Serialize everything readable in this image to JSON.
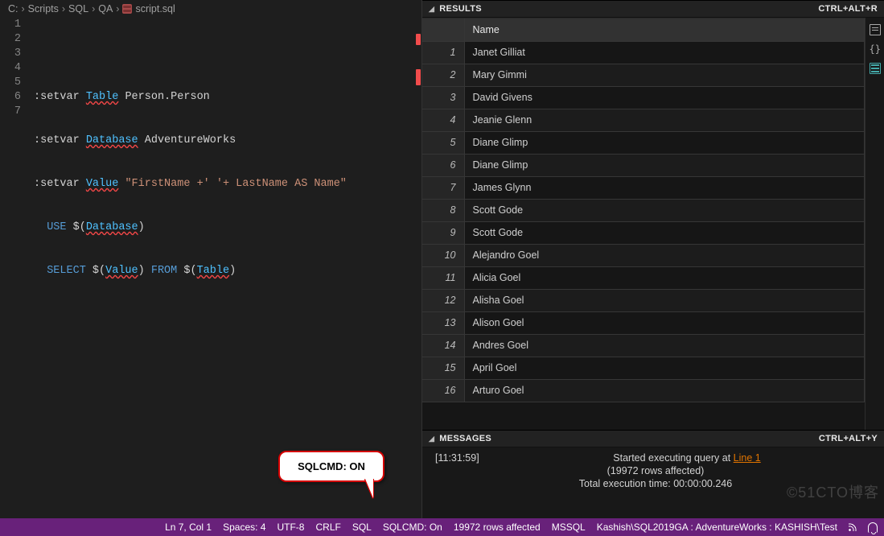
{
  "breadcrumb": [
    "C:",
    "Scripts",
    "SQL",
    "QA",
    "script.sql"
  ],
  "editor": {
    "line_count": 7,
    "tokens": {
      "setvar": ":setvar",
      "table_var": "Table",
      "table_val": "Person.Person",
      "db_var": "Database",
      "db_val": "AdventureWorks",
      "value_var": "Value",
      "value_str": "\"FirstName +' '+ LastName AS Name\"",
      "use": "USE",
      "select": "SELECT",
      "from": "FROM",
      "dollar_open": "$(",
      "close_paren": ")"
    }
  },
  "callout": {
    "text": "SQLCMD: ON"
  },
  "results": {
    "title": "RESULTS",
    "hotkey": "CTRL+ALT+R",
    "column": "Name",
    "rows": [
      "Janet Gilliat",
      "Mary Gimmi",
      "David Givens",
      "Jeanie Glenn",
      "Diane Glimp",
      "Diane Glimp",
      "James Glynn",
      "Scott Gode",
      "Scott Gode",
      "Alejandro Goel",
      "Alicia Goel",
      "Alisha Goel",
      "Alison Goel",
      "Andres Goel",
      "April Goel",
      "Arturo Goel"
    ],
    "side_icons": [
      "save-csv-icon",
      "save-json-icon",
      "save-excel-icon"
    ]
  },
  "messages": {
    "title": "MESSAGES",
    "hotkey": "CTRL+ALT+Y",
    "time": "[11:31:59]",
    "started_prefix": "Started executing query at ",
    "started_link": "Line 1",
    "affected": "(19972 rows affected)",
    "total": "Total execution time: 00:00:00.246"
  },
  "status": {
    "pos": "Ln 7, Col 1",
    "spaces": "Spaces: 4",
    "enc": "UTF-8",
    "eol": "CRLF",
    "lang": "SQL",
    "sqlcmd": "SQLCMD: On",
    "rows": "19972 rows affected",
    "engine": "MSSQL",
    "conn": "Kashish\\SQL2019GA : AdventureWorks : KASHISH\\Test"
  },
  "watermark": "©51CTO博客"
}
